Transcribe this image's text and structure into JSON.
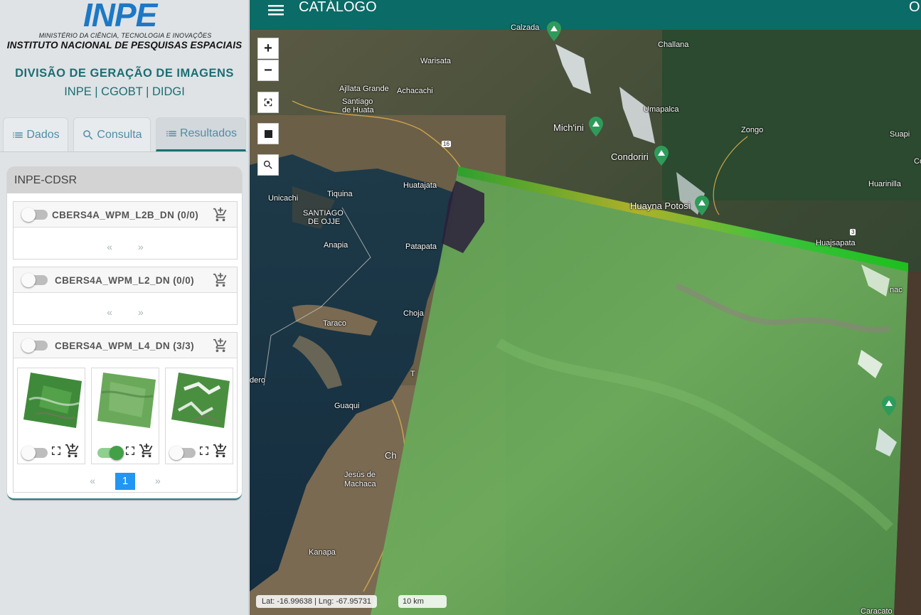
{
  "header": {
    "logo_text": "INPE",
    "ministry": "MINISTÉRIO DA CIÊNCIA, TECNOLOGIA E INOVAÇÕES",
    "institute": "INSTITUTO NACIONAL DE PESQUISAS ESPACIAIS",
    "division": "DIVISÃO DE GERAÇÃO DE IMAGENS",
    "subline": "INPE | CGOBT | DIDGI"
  },
  "tabs": [
    {
      "label": "Dados",
      "icon": "list-icon",
      "active": false
    },
    {
      "label": "Consulta",
      "icon": "search-icon",
      "active": false
    },
    {
      "label": "Resultados",
      "icon": "list-icon",
      "active": true
    }
  ],
  "results": {
    "provider": "INPE-CDSR",
    "collections": [
      {
        "name": "CBERS4A_WPM_L2B_DN",
        "count": "(0/0)",
        "enabled": false,
        "prev": "«",
        "next": "»"
      },
      {
        "name": "CBERS4A_WPM_L2_DN",
        "count": "(0/0)",
        "enabled": false,
        "prev": "«",
        "next": "»"
      },
      {
        "name": "CBERS4A_WPM_L4_DN",
        "count": "(3/3)",
        "enabled": false,
        "prev": "«",
        "next": "»",
        "page": "1",
        "scenes": [
          {
            "visible": false
          },
          {
            "visible": true
          },
          {
            "visible": false
          }
        ]
      }
    ]
  },
  "map": {
    "title": "CATÁLOGO",
    "title_right": "OI",
    "zoom_in": "+",
    "zoom_out": "−",
    "coords": "Lat: -16.99638 | Lng: -67.95731",
    "scale": "10 km",
    "places": [
      "Calzada",
      "Challana",
      "Warisata",
      "Ajllata Grande",
      "Achacachi",
      "Santiago",
      "de Huata",
      "Umapalca",
      "Mich'ini",
      "Zongo",
      "Suapi",
      "Condoriri",
      "16",
      "Huatajata",
      "Tiquina",
      "Unicachi",
      "SANTIAGO",
      "DE OJJE",
      "Huayna Potosi",
      "Huarinilla",
      "Co",
      "3",
      "Anapia",
      "Patapata",
      "Huajsapata",
      "Taraco",
      "Choja",
      "dero",
      "Guaqui",
      "Ch",
      "Jesús de",
      "Machaca",
      "Kanapa",
      "Caracato",
      "nac",
      "T"
    ]
  },
  "colors": {
    "teal": "#0b6b66",
    "accent": "#2196f3",
    "toggle_on": "#43a047"
  }
}
